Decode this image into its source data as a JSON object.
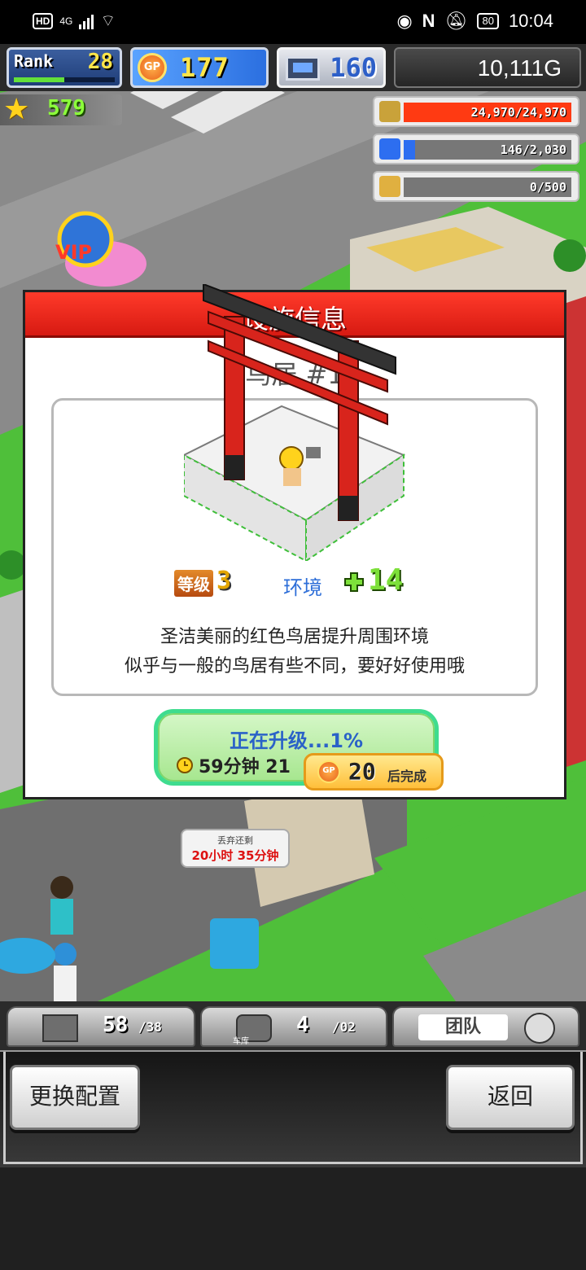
{
  "status_bar": {
    "network_badge": "HD",
    "network_type": "4G",
    "battery": "80",
    "time": "10:04"
  },
  "hud": {
    "rank_label": "Rank",
    "rank_value": "28",
    "rank_progress": 0.5,
    "gp_label": "GP",
    "gp_value": "177",
    "pc_value": "160",
    "money": "10,111G",
    "star_value": "579"
  },
  "resources": [
    {
      "icon": "coin-stack-icon",
      "text": "24,970/24,970",
      "fill": 1.0,
      "color": "#ff3a12"
    },
    {
      "icon": "fuel-can-icon",
      "text": "146/2,030",
      "fill": 0.07,
      "color": "#2d6ef0"
    },
    {
      "icon": "wheat-icon",
      "text": "0/500",
      "fill": 0.0,
      "color": "#f0b02d"
    }
  ],
  "dialog": {
    "title": "设施信息",
    "facility_name": "鸟居 #1",
    "level_label": "等级",
    "level_value": "3",
    "env_label": "环境",
    "env_value": "14",
    "desc_line1": "圣洁美丽的红色鸟居提升周围环境",
    "desc_line2": "似乎与一般的鸟居有些不同，要好好使用哦",
    "upgrade_status": "正在升级...1%",
    "upgrade_time": "59分钟 21",
    "finish_cost": "20",
    "finish_label": "后完成"
  },
  "discard_tooltip": {
    "label": "丢弃还剩",
    "time": "20小时 35分钟"
  },
  "tabs": {
    "items_count": "58",
    "items_cap": "/38",
    "garage_label": "车库",
    "garage_count": "4",
    "garage_cap": "/02",
    "team_label": "团队"
  },
  "buttons": {
    "change_config": "更换配置",
    "back": "返回"
  }
}
